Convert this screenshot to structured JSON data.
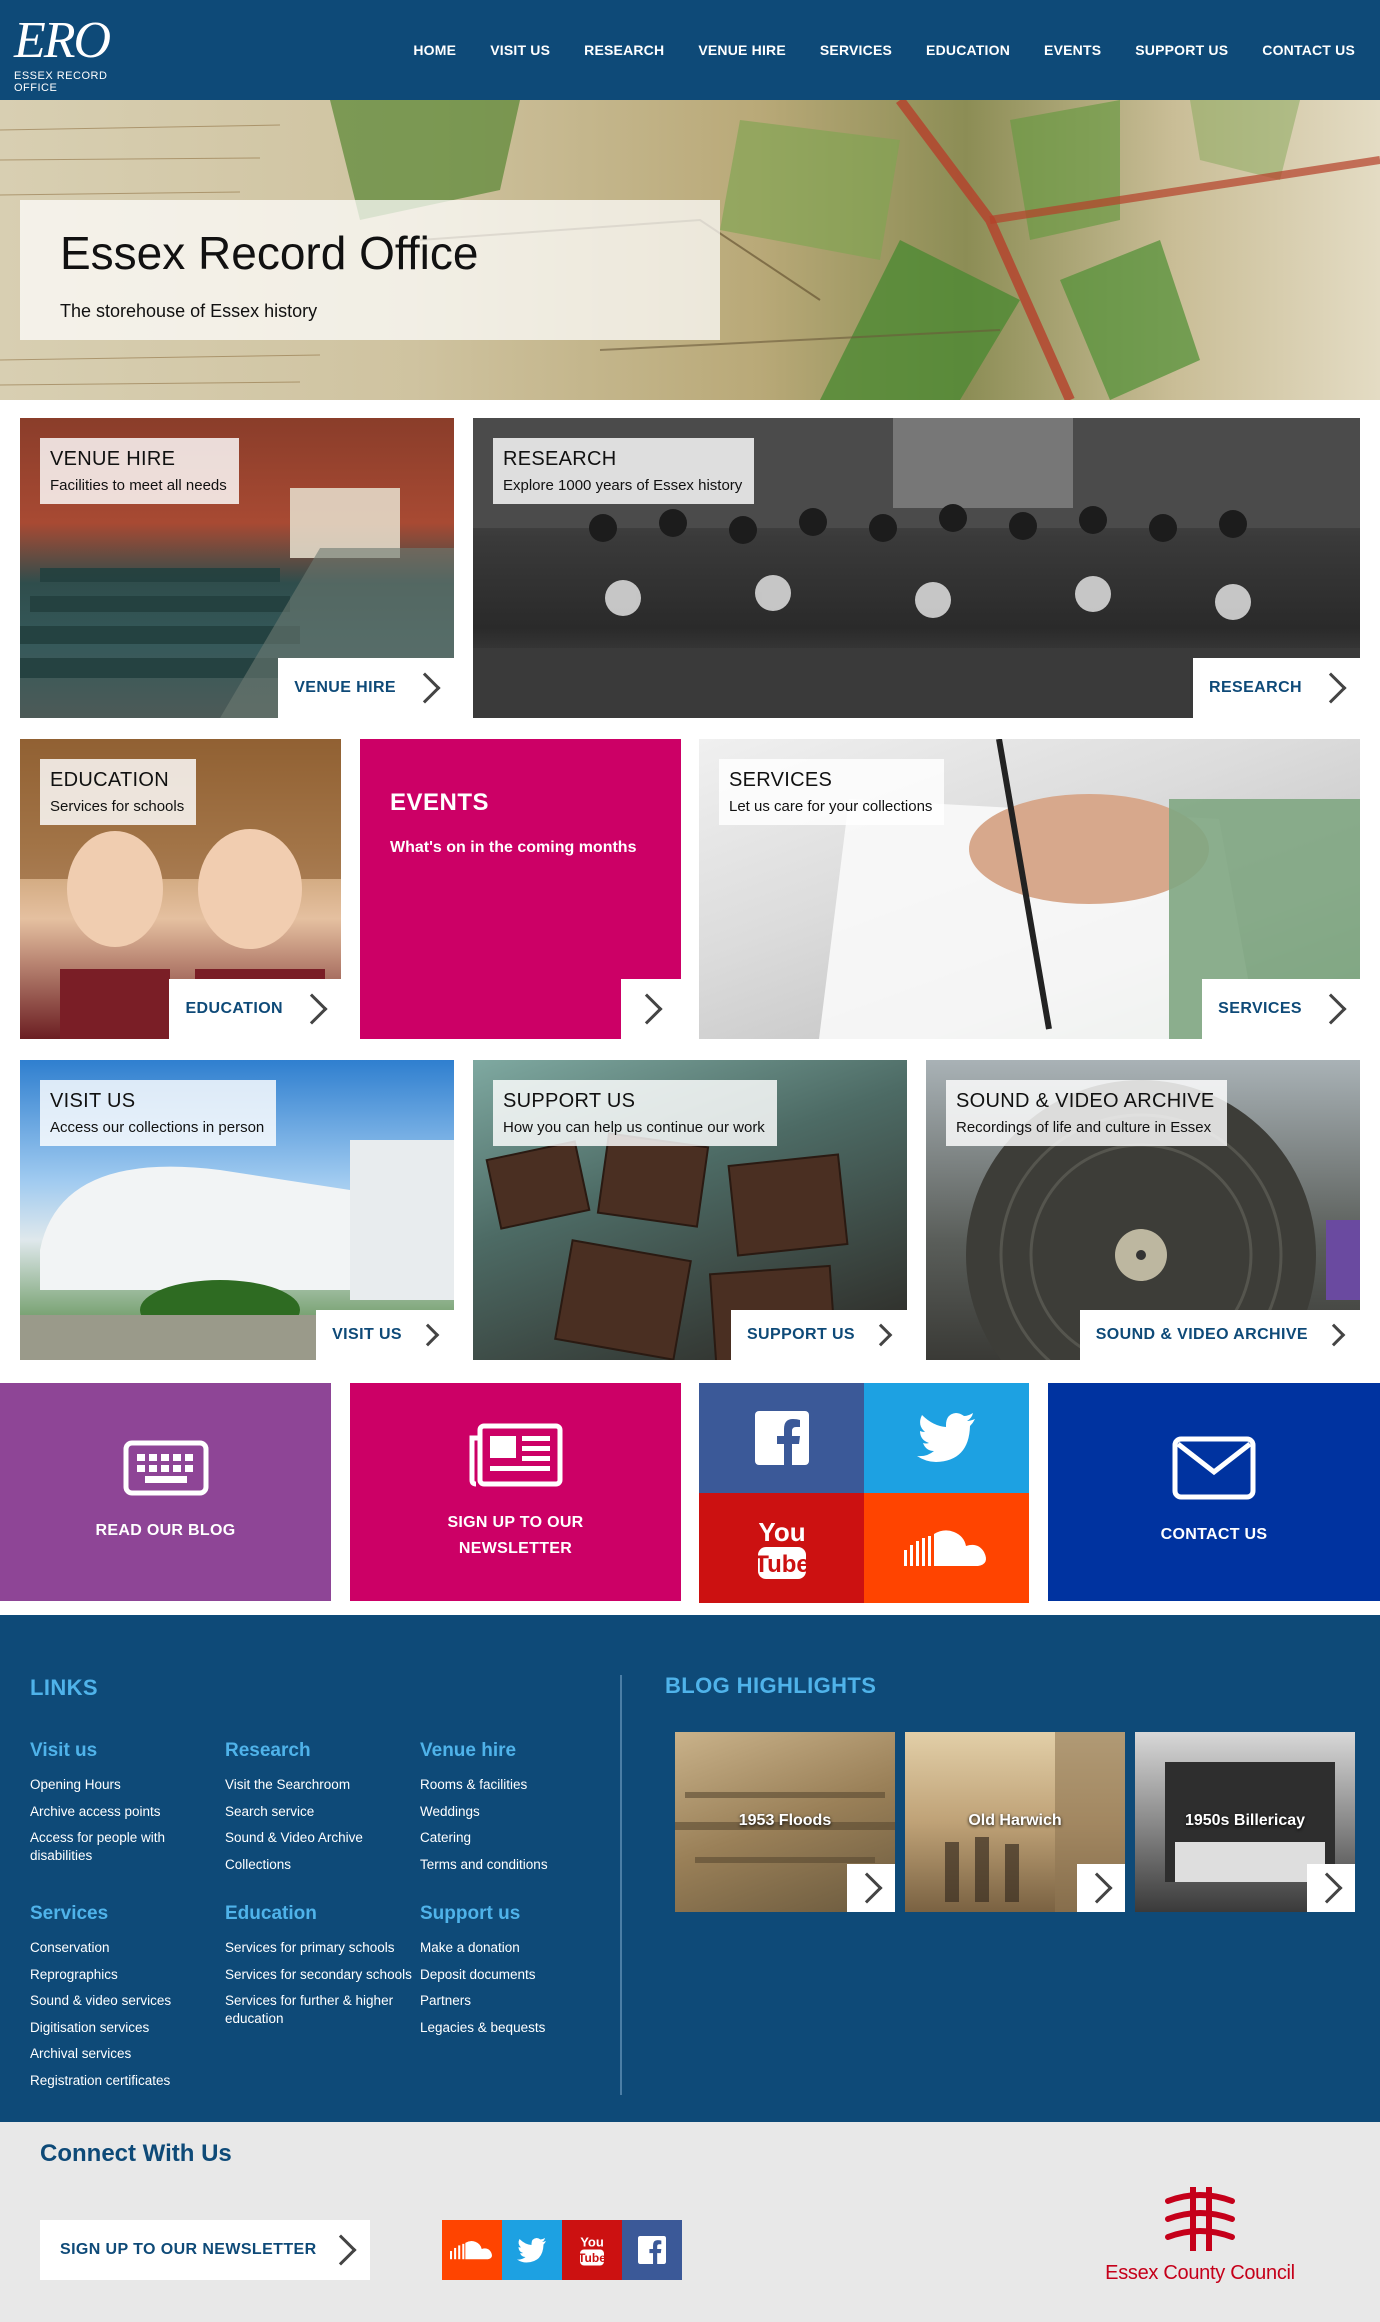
{
  "header": {
    "logo_mark": "ERO",
    "logo_text": "ESSEX RECORD OFFICE",
    "nav": [
      "HOME",
      "VISIT US",
      "RESEARCH",
      "VENUE HIRE",
      "SERVICES",
      "EDUCATION",
      "EVENTS",
      "SUPPORT US",
      "CONTACT US"
    ]
  },
  "hero": {
    "title": "Essex Record Office",
    "subtitle": "The storehouse of Essex history"
  },
  "tiles": {
    "venue": {
      "title": "VENUE HIRE",
      "sub": "Facilities to meet all needs",
      "button": "VENUE HIRE"
    },
    "research": {
      "title": "RESEARCH",
      "sub": "Explore 1000 years of Essex history",
      "button": "RESEARCH"
    },
    "education": {
      "title": "EDUCATION",
      "sub": "Services for schools",
      "button": "EDUCATION"
    },
    "events": {
      "title": "EVENTS",
      "sub": "What's on in the coming months"
    },
    "services": {
      "title": "SERVICES",
      "sub": "Let us care for your collections",
      "button": "SERVICES"
    },
    "visit": {
      "title": "VISIT US",
      "sub": "Access our collections in person",
      "button": "VISIT US"
    },
    "support": {
      "title": "SUPPORT US",
      "sub": "How you can help us continue our work",
      "button": "SUPPORT US"
    },
    "sound": {
      "title": "SOUND & VIDEO ARCHIVE",
      "sub": "Recordings of life and culture in Essex",
      "button": "SOUND & VIDEO ARCHIVE"
    }
  },
  "cta": {
    "blog": "READ OUR BLOG",
    "newsletter_1": "SIGN UP TO OUR",
    "newsletter_2": "NEWSLETTER",
    "contact": "CONTACT US"
  },
  "links": {
    "heading": "LINKS",
    "columns": [
      {
        "title": "Visit us",
        "items": [
          "Opening Hours",
          "Archive access points",
          "Access for people with disabilities"
        ]
      },
      {
        "title": "Research",
        "items": [
          "Visit the Searchroom",
          "Search service",
          "Sound & Video Archive",
          "Collections"
        ]
      },
      {
        "title": "Venue hire",
        "items": [
          "Rooms & facilities",
          "Weddings",
          "Catering",
          "Terms and conditions"
        ]
      },
      {
        "title": "Services",
        "items": [
          "Conservation",
          "Reprographics",
          "Sound & video services",
          "Digitisation services",
          "Archival services",
          "Registration certificates"
        ]
      },
      {
        "title": "Education",
        "items": [
          "Services for primary schools",
          "Services for secondary schools",
          "Services for further & higher education"
        ]
      },
      {
        "title": "Support us",
        "items": [
          "Make a donation",
          "Deposit documents",
          "Partners",
          "Legacies & bequests"
        ]
      }
    ]
  },
  "blog": {
    "heading": "BLOG HIGHLIGHTS",
    "items": [
      "1953 Floods",
      "Old Harwich",
      "1950s Billericay"
    ]
  },
  "connect": {
    "heading": "Connect With Us",
    "newsletter_button": "SIGN UP TO OUR NEWSLETTER",
    "council": "Essex County Council"
  },
  "colors": {
    "brand_blue": "#0e4a78",
    "link_blue": "#4fb3ea",
    "events_magenta": "#cc0066",
    "blog_purple": "#8e4596",
    "newsletter_magenta": "#cc0066",
    "facebook": "#3b5998",
    "twitter": "#1da1e2",
    "youtube": "#cc1111",
    "soundcloud": "#ff4400",
    "contact_blue": "#0033a0",
    "council_red": "#c5001a"
  }
}
